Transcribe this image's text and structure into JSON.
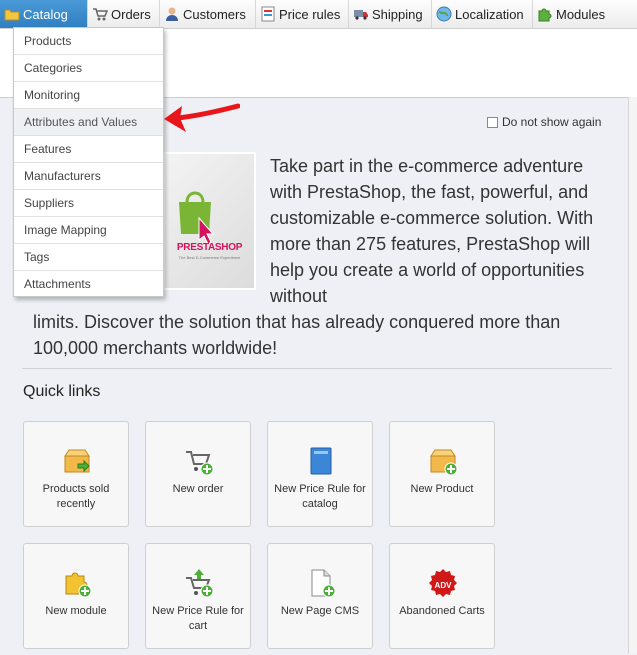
{
  "nav": {
    "tabs": [
      {
        "label": "Catalog",
        "icon": "folder-icon",
        "active": true
      },
      {
        "label": "Orders",
        "icon": "cart-icon"
      },
      {
        "label": "Customers",
        "icon": "customer-icon"
      },
      {
        "label": "Price rules",
        "icon": "price-rules-icon"
      },
      {
        "label": "Shipping",
        "icon": "truck-icon"
      },
      {
        "label": "Localization",
        "icon": "globe-icon"
      },
      {
        "label": "Modules",
        "icon": "puzzle-icon"
      }
    ]
  },
  "catalog_menu": {
    "items": [
      {
        "label": "Products"
      },
      {
        "label": "Categories"
      },
      {
        "label": "Monitoring"
      },
      {
        "label": "Attributes and Values",
        "highlighted": true
      },
      {
        "label": "Features"
      },
      {
        "label": "Manufacturers"
      },
      {
        "label": "Suppliers"
      },
      {
        "label": "Image Mapping"
      },
      {
        "label": "Tags"
      },
      {
        "label": "Attachments"
      }
    ]
  },
  "welcome": {
    "dont_show_label": "Do not show again",
    "logo_text": "PRESTASHOP",
    "logo_tagline": "The Best E-Commerce Experience",
    "intro_part1": "Take part in the e-commerce adventure with PrestaShop, the fast, powerful, and customizable e-commerce solution. With more than 275 features, PrestaShop will help you create a world of opportunities without",
    "intro_part2": "limits. Discover the solution that has already conquered more than 100,000 merchants worldwide!"
  },
  "quick_links": {
    "title": "Quick links",
    "items": [
      {
        "label": "Products sold recently",
        "icon": "box-arrow-icon"
      },
      {
        "label": "New order",
        "icon": "cart-add-icon"
      },
      {
        "label": "New Price Rule for catalog",
        "icon": "book-icon"
      },
      {
        "label": "New Product",
        "icon": "box-add-icon"
      },
      {
        "label": "New module",
        "icon": "puzzle-add-icon"
      },
      {
        "label": "New Price Rule for cart",
        "icon": "cart-up-add-icon"
      },
      {
        "label": "New Page CMS",
        "icon": "page-add-icon"
      },
      {
        "label": "Abandoned Carts",
        "icon": "adv-badge-icon",
        "badge_text": "ADV"
      }
    ]
  },
  "colors": {
    "accent": "#2f7fc2",
    "arrow": "#e8161b",
    "prestashop_green": "#7ab535",
    "prestashop_pink": "#d3135d"
  }
}
